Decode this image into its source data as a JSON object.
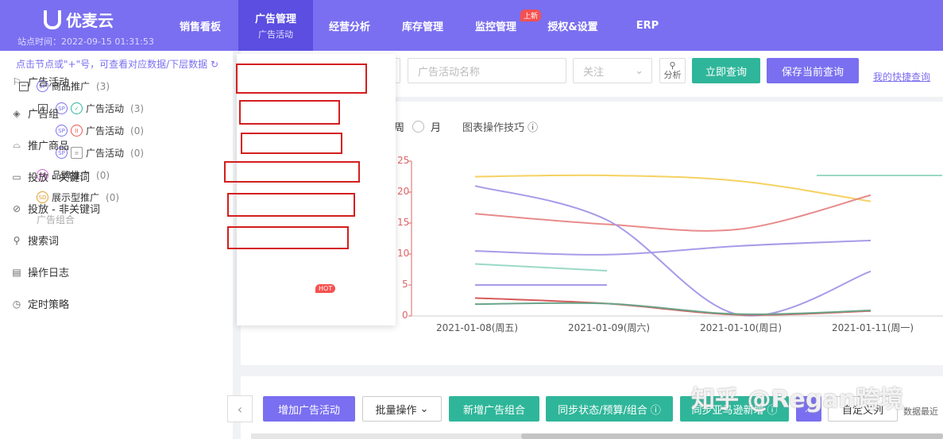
{
  "header": {
    "logo_text": "优麦云",
    "site_time": "站点时间：2022-09-15 01:31:53",
    "nav": [
      {
        "label": "销售看板"
      },
      {
        "label": "广告管理",
        "sub": "广告活动"
      },
      {
        "label": "经营分析"
      },
      {
        "label": "库存管理"
      },
      {
        "label": "监控管理",
        "badge": "上新"
      },
      {
        "label": "授权&设置"
      },
      {
        "label": "ERP"
      }
    ]
  },
  "sidebar": {
    "hint": "点击节点或\"+\"号，可查看对应数据/下层数据",
    "tree": [
      {
        "label": "商品推广",
        "count": "(3)",
        "toggle": "−",
        "tag": "SP"
      },
      {
        "label": "广告活动",
        "count": "(3)",
        "toggle": "+",
        "tag": "SP"
      },
      {
        "label": "广告活动",
        "count": "(0)",
        "tag": "SP"
      },
      {
        "label": "广告活动",
        "count": "(0)",
        "tag": "SP"
      },
      {
        "label": "品牌推广",
        "count": "(0)",
        "tag": "SB"
      },
      {
        "label": "展示型推广",
        "count": "(0)",
        "tag": "SD"
      },
      {
        "label": "广告组合"
      }
    ]
  },
  "filters": {
    "campaign_placeholder": "广告活动名称",
    "follow_select": "关注",
    "analyze_label": "分析",
    "query_button": "立即查询",
    "save_query_button": "保存当前查询",
    "quick_query_link": "我的快捷查询"
  },
  "dropdown": {
    "items": [
      {
        "label": "广告活动",
        "icon": "flag-icon"
      },
      {
        "label": "广告组",
        "icon": "layers-icon"
      },
      {
        "label": "推广商品",
        "icon": "product-icon"
      },
      {
        "label": "投放 - 关键词",
        "icon": "keyword-icon"
      },
      {
        "label": "投放 - 非关键词",
        "icon": "target-icon"
      },
      {
        "label": "搜索词",
        "icon": "search-icon"
      },
      {
        "label": "操作日志",
        "icon": "log-icon"
      },
      {
        "label": "定时策略",
        "icon": "clock-icon",
        "badge": "HOT"
      }
    ]
  },
  "chart_controls": {
    "week_partial": "周",
    "month_label": "月",
    "tips_label": "图表操作技巧"
  },
  "chart_data": {
    "type": "line",
    "x": [
      "2021-01-08(周五)",
      "2021-01-09(周六)",
      "2021-01-10(周日)",
      "2021-01-11(周一)"
    ],
    "yticks": [
      "25",
      "20",
      "15",
      "10",
      "5",
      "0"
    ],
    "ylim": [
      0,
      25
    ],
    "series": [
      {
        "color": "#f5d262",
        "values": [
          22.5,
          22.7,
          21.8,
          18.5
        ]
      },
      {
        "color": "#e88b8b",
        "values": [
          16.5,
          14.8,
          14,
          19.5
        ]
      },
      {
        "color": "#a89be8",
        "values": [
          21,
          15.5,
          0.2,
          7.2
        ]
      },
      {
        "color": "#a89be8",
        "values": [
          10.5,
          9.9,
          11.3,
          12.2
        ]
      },
      {
        "color": "#9ad9c7",
        "values": [
          8.4,
          7.3,
          null,
          22.7
        ]
      },
      {
        "color": "#a89be8",
        "values": [
          5,
          5,
          null,
          null
        ]
      },
      {
        "color": "#d65c5c",
        "values": [
          2.9,
          2,
          0.2,
          0.8
        ]
      },
      {
        "color": "#6ba48a",
        "values": [
          1.9,
          2,
          0.3,
          0.9
        ]
      }
    ]
  },
  "bottom_bar": {
    "add_campaign": "增加广告活动",
    "batch_ops": "批量操作",
    "new_group": "新增广告组合",
    "sync_status": "同步状态/预算/组合",
    "sync_amazon": "同步亚马逊新增",
    "custom_columns": "自定义列",
    "data_recent": "数据最近"
  },
  "watermark": "知乎 @Regan跨境"
}
